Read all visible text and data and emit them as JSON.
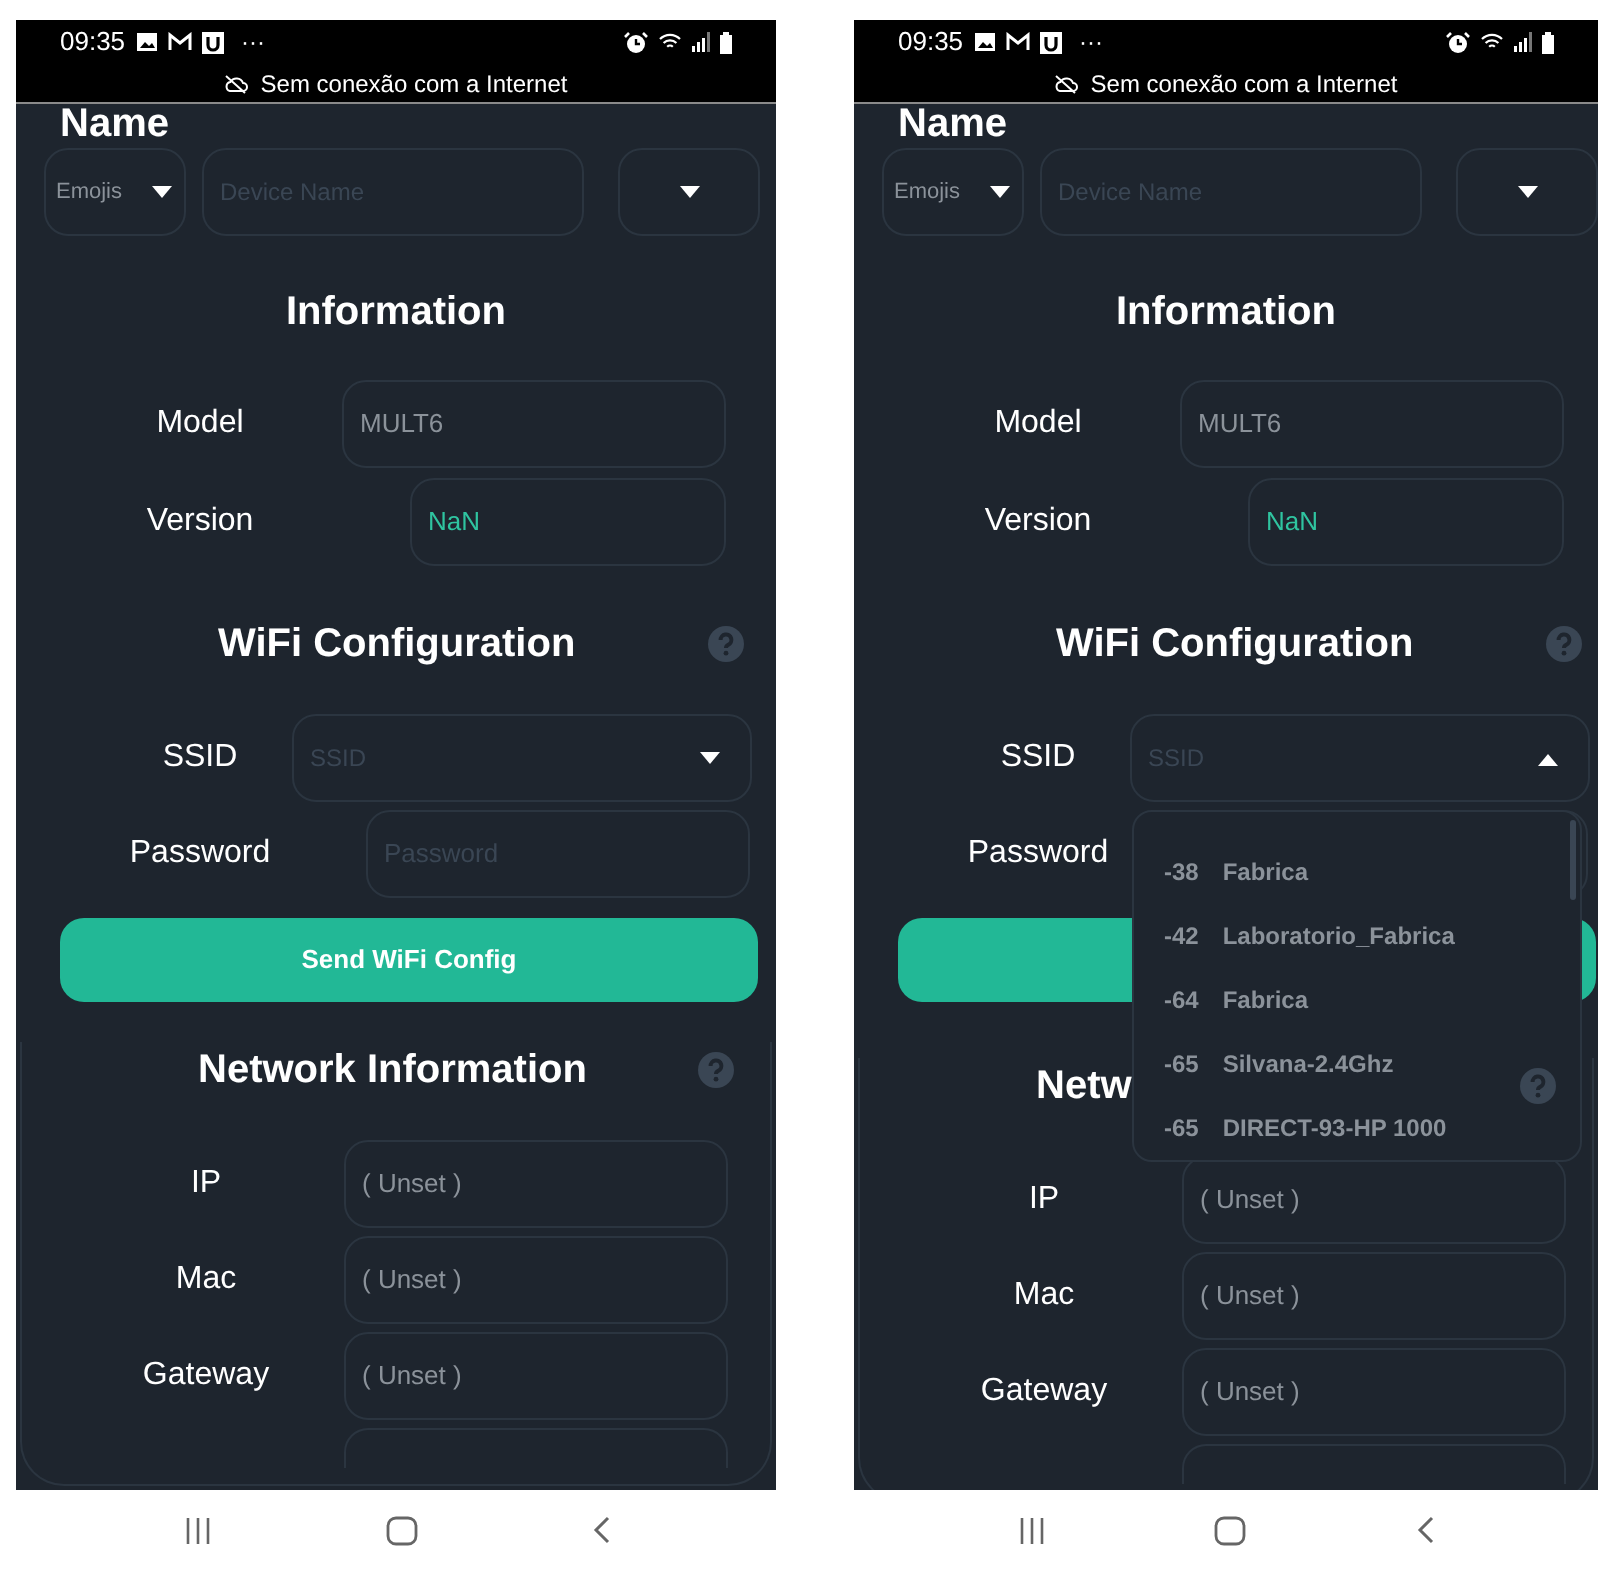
{
  "screens": [
    {
      "status_bar": {
        "time": "09:35",
        "more": "···"
      },
      "banner": "Sem conexão com a Internet",
      "name_section": {
        "title": "Name",
        "emoji_select": "Emojis",
        "device_name_placeholder": "Device Name"
      },
      "information": {
        "title": "Information",
        "fields": [
          {
            "label": "Model",
            "value": "MULT6",
            "kind": "plain"
          },
          {
            "label": "Version",
            "value": "NaN",
            "kind": "accent"
          }
        ]
      },
      "wifi": {
        "title": "WiFi Configuration",
        "ssid": {
          "label": "SSID",
          "placeholder": "SSID",
          "expanded": false
        },
        "password": {
          "label": "Password",
          "placeholder": "Password"
        },
        "send_button": "Send WiFi Config"
      },
      "network": {
        "title": "Network Information",
        "fields": [
          {
            "label": "IP",
            "value": "( Unset )"
          },
          {
            "label": "Mac",
            "value": "( Unset )"
          },
          {
            "label": "Gateway",
            "value": "( Unset )"
          }
        ]
      }
    },
    {
      "status_bar": {
        "time": "09:35",
        "more": "···"
      },
      "banner": "Sem conexão com a Internet",
      "name_section": {
        "title": "Name",
        "emoji_select": "Emojis",
        "device_name_placeholder": "Device Name"
      },
      "information": {
        "title": "Information",
        "fields": [
          {
            "label": "Model",
            "value": "MULT6",
            "kind": "plain"
          },
          {
            "label": "Version",
            "value": "NaN",
            "kind": "accent"
          }
        ]
      },
      "wifi": {
        "title": "WiFi Configuration",
        "ssid": {
          "label": "SSID",
          "placeholder": "SSID",
          "expanded": true,
          "options": [
            {
              "signal": "-38",
              "name": "Fabrica"
            },
            {
              "signal": "-42",
              "name": "Laboratorio_Fabrica"
            },
            {
              "signal": "-64",
              "name": "Fabrica"
            },
            {
              "signal": "-65",
              "name": "Silvana-2.4Ghz"
            },
            {
              "signal": "-65",
              "name": "DIRECT-93-HP 1000"
            }
          ]
        },
        "password": {
          "label": "Password"
        }
      },
      "network": {
        "title": "Netw",
        "fields": [
          {
            "label": "IP",
            "value": "( Unset )"
          },
          {
            "label": "Mac",
            "value": "( Unset )"
          },
          {
            "label": "Gateway",
            "value": "( Unset )"
          }
        ]
      }
    }
  ]
}
